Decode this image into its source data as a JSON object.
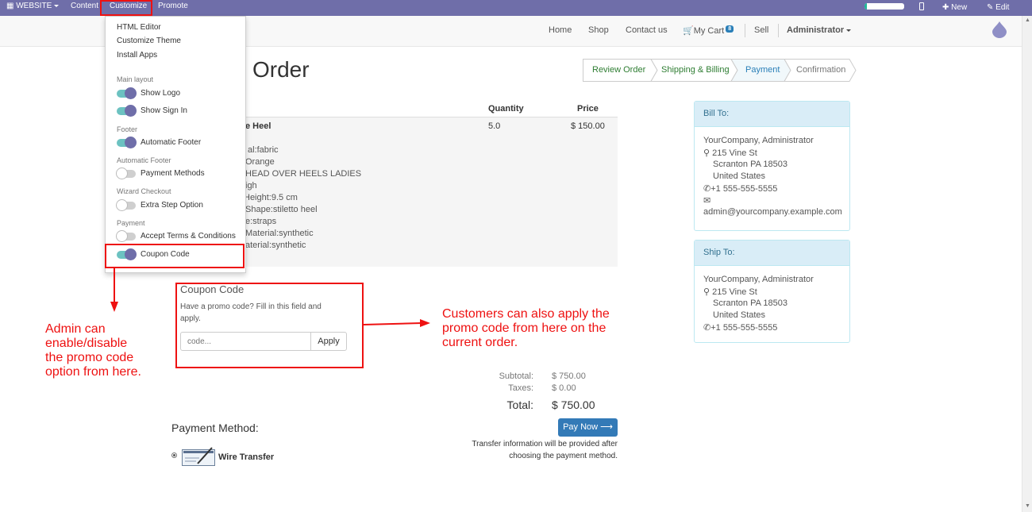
{
  "topbar": {
    "website_label": "WEBSITE",
    "menu": [
      "Content",
      "Customize",
      "Promote"
    ],
    "new_label": "New",
    "edit_label": "Edit"
  },
  "navbar": {
    "links": [
      "Home",
      "Shop",
      "Contact us"
    ],
    "cart_label": "My Cart",
    "cart_count": "8",
    "sell_label": "Sell",
    "user_label": "Administrator"
  },
  "dropdown": {
    "items": [
      "HTML Editor",
      "Customize Theme",
      "Install Apps"
    ],
    "sections": [
      {
        "header": "Main layout",
        "options": [
          {
            "label": "Show Logo",
            "on": true
          },
          {
            "label": "Show Sign In",
            "on": true
          }
        ]
      },
      {
        "header": "Footer",
        "options": [
          {
            "label": "Automatic Footer",
            "on": true
          }
        ]
      },
      {
        "header": "Automatic Footer",
        "options": [
          {
            "label": "Payment Methods",
            "on": false
          }
        ]
      },
      {
        "header": "Wizard Checkout",
        "options": [
          {
            "label": "Extra Step Option",
            "on": false
          }
        ]
      },
      {
        "header": "Payment",
        "options": [
          {
            "label": "Accept Terms & Conditions",
            "on": false
          },
          {
            "label": "Coupon Code",
            "on": true
          }
        ]
      }
    ]
  },
  "page": {
    "title_visible": "Order",
    "wizard": [
      "Review Order",
      "Shipping & Billing",
      "Payment",
      "Confirmation"
    ]
  },
  "table": {
    "headers": {
      "quantity": "Quantity",
      "price": "Price"
    },
    "product_name_visible": "e Heel",
    "quantity": "5.0",
    "price": "$ 150.00",
    "attributes_visible": [
      "al:fabric",
      "Orange",
      "HEAD OVER HEELS LADIES",
      "igh",
      "Height:9.5 cm",
      "Shape:stiletto heel",
      "e:straps",
      "Material:synthetic",
      "aterial:synthetic"
    ]
  },
  "coupon": {
    "title": "Coupon Code",
    "hint": "Have a promo code? Fill in this field and apply.",
    "placeholder": "code...",
    "apply_label": "Apply"
  },
  "totals": {
    "subtotal_label": "Subtotal:",
    "subtotal": "$ 750.00",
    "taxes_label": "Taxes:",
    "taxes": "$ 0.00",
    "total_label": "Total:",
    "total": "$ 750.00"
  },
  "payment": {
    "heading": "Payment Method:",
    "method": "Wire Transfer",
    "pay_now_label": "Pay Now",
    "transfer_info_line1": "Transfer information will be provided after",
    "transfer_info_line2": "choosing the payment method."
  },
  "bill_to": {
    "heading": "Bill To:",
    "company": "YourCompany, Administrator",
    "street": "215 Vine St",
    "city": "Scranton PA 18503",
    "country": "United States",
    "phone": "+1 555-555-5555",
    "email": "admin@yourcompany.example.com"
  },
  "ship_to": {
    "heading": "Ship To:",
    "company": "YourCompany, Administrator",
    "street": "215 Vine St",
    "city": "Scranton PA 18503",
    "country": "United States",
    "phone": "+1 555-555-5555"
  },
  "annotations": {
    "left_line1": "Admin can",
    "left_line2": "enable/disable",
    "left_line3": "the promo code",
    "left_line4": "option from here.",
    "right_line1": "Customers can also apply the",
    "right_line2": "promo code from here on the",
    "right_line3": "current order."
  },
  "colors": {
    "admin_bar": "#6f6ea9",
    "annotation_red": "#ee1111",
    "primary_button": "#337ab7",
    "info_panel": "#d9edf7"
  }
}
